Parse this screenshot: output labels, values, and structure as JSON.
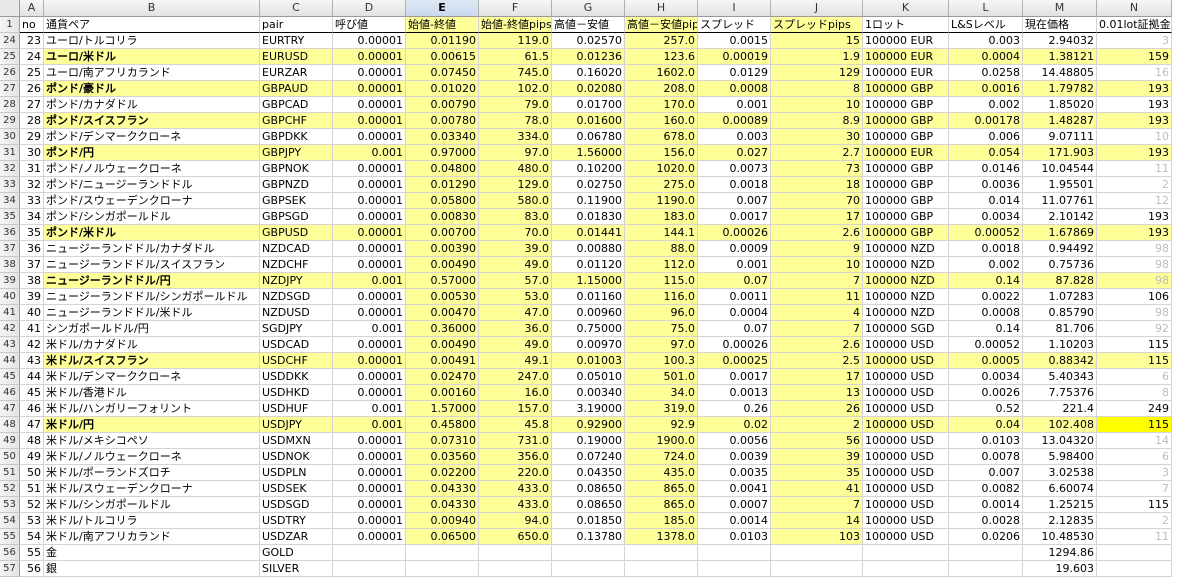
{
  "columns": [
    "A",
    "B",
    "C",
    "D",
    "E",
    "F",
    "G",
    "H",
    "I",
    "J",
    "K",
    "L",
    "M",
    "N"
  ],
  "active_column": "E",
  "header_row_number": "1",
  "headers": [
    "no",
    "通貨ペア",
    "pair",
    "呼び値",
    "始値-終値",
    "始値-終値pips",
    "高値－安値",
    "高値－安値pips",
    "スプレッド",
    "スプレッドpips",
    "1ロット",
    "L&Sレベル",
    "現在価格",
    "0.01lot証拠金"
  ],
  "rows": [
    {
      "rn": "24",
      "c": [
        "23",
        "ユーロ/トルコリラ",
        "EURTRY",
        "0.00001",
        "0.01190",
        "119.0",
        "0.02570",
        "257.0",
        "0.0015",
        "15",
        "100000 EUR",
        "0.003",
        "2.94032",
        "3"
      ],
      "bold": false,
      "ng": true
    },
    {
      "rn": "25",
      "c": [
        "24",
        "ユーロ/米ドル",
        "EURUSD",
        "0.00001",
        "0.00615",
        "61.5",
        "0.01236",
        "123.6",
        "0.00019",
        "1.9",
        "100000 EUR",
        "0.0004",
        "1.38121",
        "159"
      ],
      "bold": true,
      "ng": false
    },
    {
      "rn": "26",
      "c": [
        "25",
        "ユーロ/南アフリカランド",
        "EURZAR",
        "0.00001",
        "0.07450",
        "745.0",
        "0.16020",
        "1602.0",
        "0.0129",
        "129",
        "100000 EUR",
        "0.0258",
        "14.48805",
        "16"
      ],
      "bold": false,
      "ng": true
    },
    {
      "rn": "27",
      "c": [
        "26",
        "ポンド/豪ドル",
        "GBPAUD",
        "0.00001",
        "0.01020",
        "102.0",
        "0.02080",
        "208.0",
        "0.0008",
        "8",
        "100000 GBP",
        "0.0016",
        "1.79782",
        "193"
      ],
      "bold": true,
      "ng": false
    },
    {
      "rn": "28",
      "c": [
        "27",
        "ポンド/カナダドル",
        "GBPCAD",
        "0.00001",
        "0.00790",
        "79.0",
        "0.01700",
        "170.0",
        "0.001",
        "10",
        "100000 GBP",
        "0.002",
        "1.85020",
        "193"
      ],
      "bold": false,
      "ng": false
    },
    {
      "rn": "29",
      "c": [
        "28",
        "ポンド/スイスフラン",
        "GBPCHF",
        "0.00001",
        "0.00780",
        "78.0",
        "0.01600",
        "160.0",
        "0.00089",
        "8.9",
        "100000 GBP",
        "0.00178",
        "1.48287",
        "193"
      ],
      "bold": true,
      "ng": false
    },
    {
      "rn": "30",
      "c": [
        "29",
        "ポンド/デンマーククローネ",
        "GBPDKK",
        "0.00001",
        "0.03340",
        "334.0",
        "0.06780",
        "678.0",
        "0.003",
        "30",
        "100000 GBP",
        "0.006",
        "9.07111",
        "10"
      ],
      "bold": false,
      "ng": true
    },
    {
      "rn": "31",
      "c": [
        "30",
        "ポンド/円",
        "GBPJPY",
        "0.001",
        "0.97000",
        "97.0",
        "1.56000",
        "156.0",
        "0.027",
        "2.7",
        "100000 EUR",
        "0.054",
        "171.903",
        "193"
      ],
      "bold": true,
      "ng": false
    },
    {
      "rn": "32",
      "c": [
        "31",
        "ポンド/ノルウェークローネ",
        "GBPNOK",
        "0.00001",
        "0.04800",
        "480.0",
        "0.10200",
        "1020.0",
        "0.0073",
        "73",
        "100000 GBP",
        "0.0146",
        "10.04544",
        "11"
      ],
      "bold": false,
      "ng": true
    },
    {
      "rn": "33",
      "c": [
        "32",
        "ポンド/ニュージーランドドル",
        "GBPNZD",
        "0.00001",
        "0.01290",
        "129.0",
        "0.02750",
        "275.0",
        "0.0018",
        "18",
        "100000 GBP",
        "0.0036",
        "1.95501",
        "2"
      ],
      "bold": false,
      "ng": true
    },
    {
      "rn": "34",
      "c": [
        "33",
        "ポンド/スウェーデンクローナ",
        "GBPSEK",
        "0.00001",
        "0.05800",
        "580.0",
        "0.11900",
        "1190.0",
        "0.007",
        "70",
        "100000 GBP",
        "0.014",
        "11.07761",
        "12"
      ],
      "bold": false,
      "ng": true
    },
    {
      "rn": "35",
      "c": [
        "34",
        "ポンド/シンガポールドル",
        "GBPSGD",
        "0.00001",
        "0.00830",
        "83.0",
        "0.01830",
        "183.0",
        "0.0017",
        "17",
        "100000 GBP",
        "0.0034",
        "2.10142",
        "193"
      ],
      "bold": false,
      "ng": false
    },
    {
      "rn": "36",
      "c": [
        "35",
        "ポンド/米ドル",
        "GBPUSD",
        "0.00001",
        "0.00700",
        "70.0",
        "0.01441",
        "144.1",
        "0.00026",
        "2.6",
        "100000 GBP",
        "0.00052",
        "1.67869",
        "193"
      ],
      "bold": true,
      "ng": false
    },
    {
      "rn": "37",
      "c": [
        "36",
        "ニュージーランドドル/カナダドル",
        "NZDCAD",
        "0.00001",
        "0.00390",
        "39.0",
        "0.00880",
        "88.0",
        "0.0009",
        "9",
        "100000 NZD",
        "0.0018",
        "0.94492",
        "98"
      ],
      "bold": false,
      "ng": true
    },
    {
      "rn": "38",
      "c": [
        "37",
        "ニュージーランドドル/スイスフラン",
        "NZDCHF",
        "0.00001",
        "0.00490",
        "49.0",
        "0.01120",
        "112.0",
        "0.001",
        "10",
        "100000 NZD",
        "0.002",
        "0.75736",
        "98"
      ],
      "bold": false,
      "ng": true
    },
    {
      "rn": "39",
      "c": [
        "38",
        "ニュージーランドドル/円",
        "NZDJPY",
        "0.001",
        "0.57000",
        "57.0",
        "1.15000",
        "115.0",
        "0.07",
        "7",
        "100000 NZD",
        "0.14",
        "87.828",
        "98"
      ],
      "bold": true,
      "ng": true
    },
    {
      "rn": "40",
      "c": [
        "39",
        "ニュージーランドドル/シンガポールドル",
        "NZDSGD",
        "0.00001",
        "0.00530",
        "53.0",
        "0.01160",
        "116.0",
        "0.0011",
        "11",
        "100000 NZD",
        "0.0022",
        "1.07283",
        "106"
      ],
      "bold": false,
      "ng": false
    },
    {
      "rn": "41",
      "c": [
        "40",
        "ニュージーランドドル/米ドル",
        "NZDUSD",
        "0.00001",
        "0.00470",
        "47.0",
        "0.00960",
        "96.0",
        "0.0004",
        "4",
        "100000 NZD",
        "0.0008",
        "0.85790",
        "98"
      ],
      "bold": false,
      "ng": true
    },
    {
      "rn": "42",
      "c": [
        "41",
        "シンガポールドル/円",
        "SGDJPY",
        "0.001",
        "0.36000",
        "36.0",
        "0.75000",
        "75.0",
        "0.07",
        "7",
        "100000 SGD",
        "0.14",
        "81.706",
        "92"
      ],
      "bold": false,
      "ng": true
    },
    {
      "rn": "43",
      "c": [
        "42",
        "米ドル/カナダドル",
        "USDCAD",
        "0.00001",
        "0.00490",
        "49.0",
        "0.00970",
        "97.0",
        "0.00026",
        "2.6",
        "100000 USD",
        "0.00052",
        "1.10203",
        "115"
      ],
      "bold": false,
      "ng": false
    },
    {
      "rn": "44",
      "c": [
        "43",
        "米ドル/スイスフラン",
        "USDCHF",
        "0.00001",
        "0.00491",
        "49.1",
        "0.01003",
        "100.3",
        "0.00025",
        "2.5",
        "100000 USD",
        "0.0005",
        "0.88342",
        "115"
      ],
      "bold": true,
      "ng": false
    },
    {
      "rn": "45",
      "c": [
        "44",
        "米ドル/デンマーククローネ",
        "USDDKK",
        "0.00001",
        "0.02470",
        "247.0",
        "0.05010",
        "501.0",
        "0.0017",
        "17",
        "100000 USD",
        "0.0034",
        "5.40343",
        "6"
      ],
      "bold": false,
      "ng": true
    },
    {
      "rn": "46",
      "c": [
        "45",
        "米ドル/香港ドル",
        "USDHKD",
        "0.00001",
        "0.00160",
        "16.0",
        "0.00340",
        "34.0",
        "0.0013",
        "13",
        "100000 USD",
        "0.0026",
        "7.75376",
        "8"
      ],
      "bold": false,
      "ng": true
    },
    {
      "rn": "47",
      "c": [
        "46",
        "米ドル/ハンガリーフォリント",
        "USDHUF",
        "0.001",
        "1.57000",
        "157.0",
        "3.19000",
        "319.0",
        "0.26",
        "26",
        "100000 USD",
        "0.52",
        "221.4",
        "249"
      ],
      "bold": false,
      "ng": false
    },
    {
      "rn": "48",
      "c": [
        "47",
        "米ドル/円",
        "USDJPY",
        "0.001",
        "0.45800",
        "45.8",
        "0.92900",
        "92.9",
        "0.02",
        "2",
        "100000 USD",
        "0.04",
        "102.408",
        "115"
      ],
      "bold": true,
      "ng": false,
      "ycell": true
    },
    {
      "rn": "49",
      "c": [
        "48",
        "米ドル/メキシコペソ",
        "USDMXN",
        "0.00001",
        "0.07310",
        "731.0",
        "0.19000",
        "1900.0",
        "0.0056",
        "56",
        "100000 USD",
        "0.0103",
        "13.04320",
        "14"
      ],
      "bold": false,
      "ng": true
    },
    {
      "rn": "50",
      "c": [
        "49",
        "米ドル/ノルウェークローネ",
        "USDNOK",
        "0.00001",
        "0.03560",
        "356.0",
        "0.07240",
        "724.0",
        "0.0039",
        "39",
        "100000 USD",
        "0.0078",
        "5.98400",
        "6"
      ],
      "bold": false,
      "ng": true
    },
    {
      "rn": "51",
      "c": [
        "50",
        "米ドル/ポーランドズロチ",
        "USDPLN",
        "0.00001",
        "0.02200",
        "220.0",
        "0.04350",
        "435.0",
        "0.0035",
        "35",
        "100000 USD",
        "0.007",
        "3.02538",
        "3"
      ],
      "bold": false,
      "ng": true
    },
    {
      "rn": "52",
      "c": [
        "51",
        "米ドル/スウェーデンクローナ",
        "USDSEK",
        "0.00001",
        "0.04330",
        "433.0",
        "0.08650",
        "865.0",
        "0.0041",
        "41",
        "100000 USD",
        "0.0082",
        "6.60074",
        "7"
      ],
      "bold": false,
      "ng": true
    },
    {
      "rn": "53",
      "c": [
        "52",
        "米ドル/シンガポールドル",
        "USDSGD",
        "0.00001",
        "0.04330",
        "433.0",
        "0.08650",
        "865.0",
        "0.0007",
        "7",
        "100000 USD",
        "0.0014",
        "1.25215",
        "115"
      ],
      "bold": false,
      "ng": false
    },
    {
      "rn": "54",
      "c": [
        "53",
        "米ドル/トルコリラ",
        "USDTRY",
        "0.00001",
        "0.00940",
        "94.0",
        "0.01850",
        "185.0",
        "0.0014",
        "14",
        "100000 USD",
        "0.0028",
        "2.12835",
        "2"
      ],
      "bold": false,
      "ng": true
    },
    {
      "rn": "55",
      "c": [
        "54",
        "米ドル/南アフリカランド",
        "USDZAR",
        "0.00001",
        "0.06500",
        "650.0",
        "0.13780",
        "1378.0",
        "0.0103",
        "103",
        "100000 USD",
        "0.0206",
        "10.48530",
        "11"
      ],
      "bold": false,
      "ng": true
    },
    {
      "rn": "56",
      "c": [
        "55",
        "金",
        "GOLD",
        "",
        "",
        "",
        "",
        "",
        "",
        "",
        "",
        "",
        "1294.86",
        ""
      ],
      "bold": false,
      "ng": false,
      "nohl": true
    },
    {
      "rn": "57",
      "c": [
        "56",
        "銀",
        "SILVER",
        "",
        "",
        "",
        "",
        "",
        "",
        "",
        "",
        "",
        "19.603",
        ""
      ],
      "bold": false,
      "ng": false,
      "nohl": true
    }
  ]
}
